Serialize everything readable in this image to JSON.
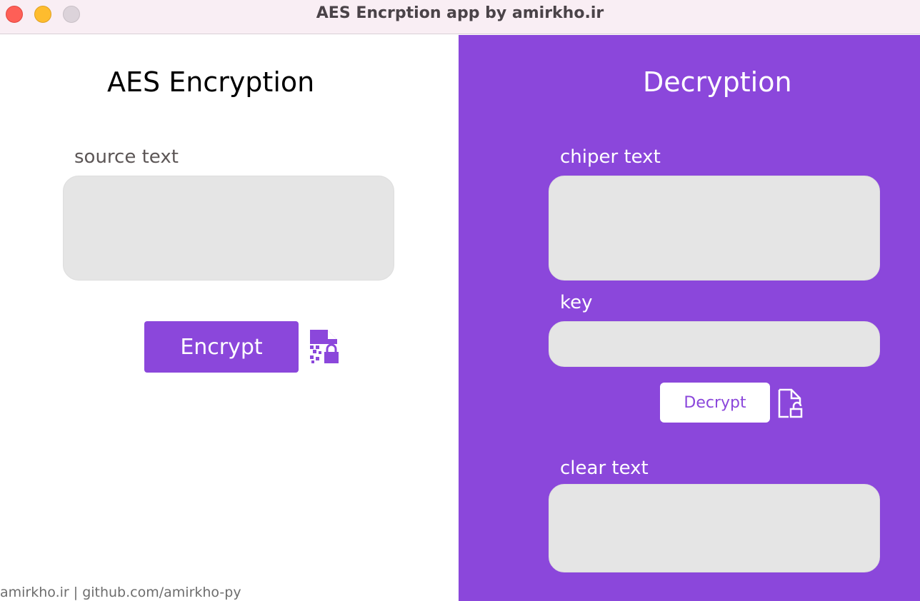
{
  "window": {
    "title": "AES Encrption app by amirkho.ir"
  },
  "encryption": {
    "heading": "AES Encryption",
    "source_label": "source text",
    "source_value": "",
    "button_label": "Encrypt"
  },
  "decryption": {
    "heading": "Decryption",
    "cipher_label": "chiper text",
    "cipher_value": "",
    "key_label": "key",
    "key_value": "",
    "button_label": "Decrypt",
    "clear_label": "clear text",
    "clear_value": ""
  },
  "footer": {
    "text": "amirkho.ir | github.com/amirkho-py"
  },
  "colors": {
    "accent": "#8b47db",
    "field_bg": "#e5e5e5",
    "titlebar_bg": "#f9eef4"
  },
  "icons": {
    "encrypt_icon": "file-encrypt-lock-icon",
    "decrypt_icon": "file-unlock-icon"
  }
}
